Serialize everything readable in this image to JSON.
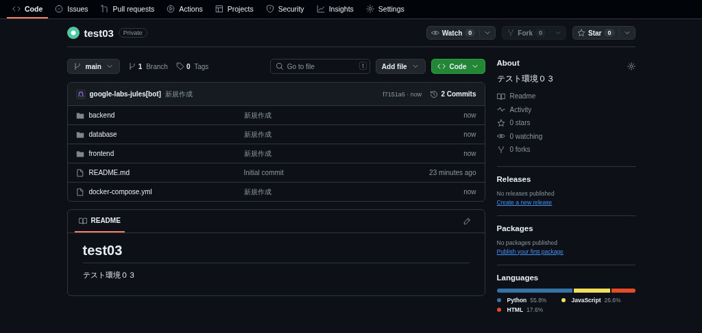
{
  "nav": {
    "tabs": [
      {
        "label": "Code",
        "selected": true
      },
      {
        "label": "Issues",
        "selected": false
      },
      {
        "label": "Pull requests",
        "selected": false
      },
      {
        "label": "Actions",
        "selected": false
      },
      {
        "label": "Projects",
        "selected": false
      },
      {
        "label": "Security",
        "selected": false
      },
      {
        "label": "Insights",
        "selected": false
      },
      {
        "label": "Settings",
        "selected": false
      }
    ]
  },
  "repo": {
    "name": "test03",
    "visibility": "Private",
    "actions": [
      {
        "label": "Watch",
        "count": "0",
        "disabled": false
      },
      {
        "label": "Fork",
        "count": "0",
        "disabled": true
      },
      {
        "label": "Star",
        "count": "0",
        "disabled": false
      }
    ]
  },
  "toolbar": {
    "branch": "main",
    "branches_count": "1",
    "branches_label": "Branch",
    "tags_count": "0",
    "tags_label": "Tags",
    "search": {
      "placeholder": "Go to file",
      "shortcut": "t"
    },
    "add_file": "Add file",
    "code": "Code"
  },
  "commit": {
    "author": "google-labs-jules[bot]",
    "message": "新規作成",
    "sha": "f7151a6 · now",
    "commits": "2 Commits"
  },
  "files": [
    {
      "kind": "folder",
      "name": "backend",
      "message": "新規作成",
      "time": "now"
    },
    {
      "kind": "folder",
      "name": "database",
      "message": "新規作成",
      "time": "now"
    },
    {
      "kind": "folder",
      "name": "frontend",
      "message": "新規作成",
      "time": "now"
    },
    {
      "kind": "file",
      "name": "README.md",
      "message": "Initial commit",
      "time": "23 minutes ago"
    },
    {
      "kind": "file",
      "name": "docker-compose.yml",
      "message": "新規作成",
      "time": "now"
    }
  ],
  "readme": {
    "tab": "README",
    "heading": "test03",
    "body": "テスト環境０３"
  },
  "about": {
    "title": "About",
    "description": "テスト環境０３",
    "items": [
      "Readme",
      "Activity",
      "0 stars",
      "0 watching",
      "0 forks"
    ]
  },
  "releases": {
    "title": "Releases",
    "note": "No releases published",
    "link": "Create a new release"
  },
  "packages": {
    "title": "Packages",
    "note": "No packages published",
    "link": "Publish your first package"
  },
  "languages": {
    "title": "Languages",
    "items": [
      {
        "name": "Python",
        "percent": "55.8%",
        "color": "#3572a5"
      },
      {
        "name": "JavaScript",
        "percent": "26.6%",
        "color": "#f1e05a"
      },
      {
        "name": "HTML",
        "percent": "17.6%",
        "color": "#e34c26"
      }
    ]
  }
}
